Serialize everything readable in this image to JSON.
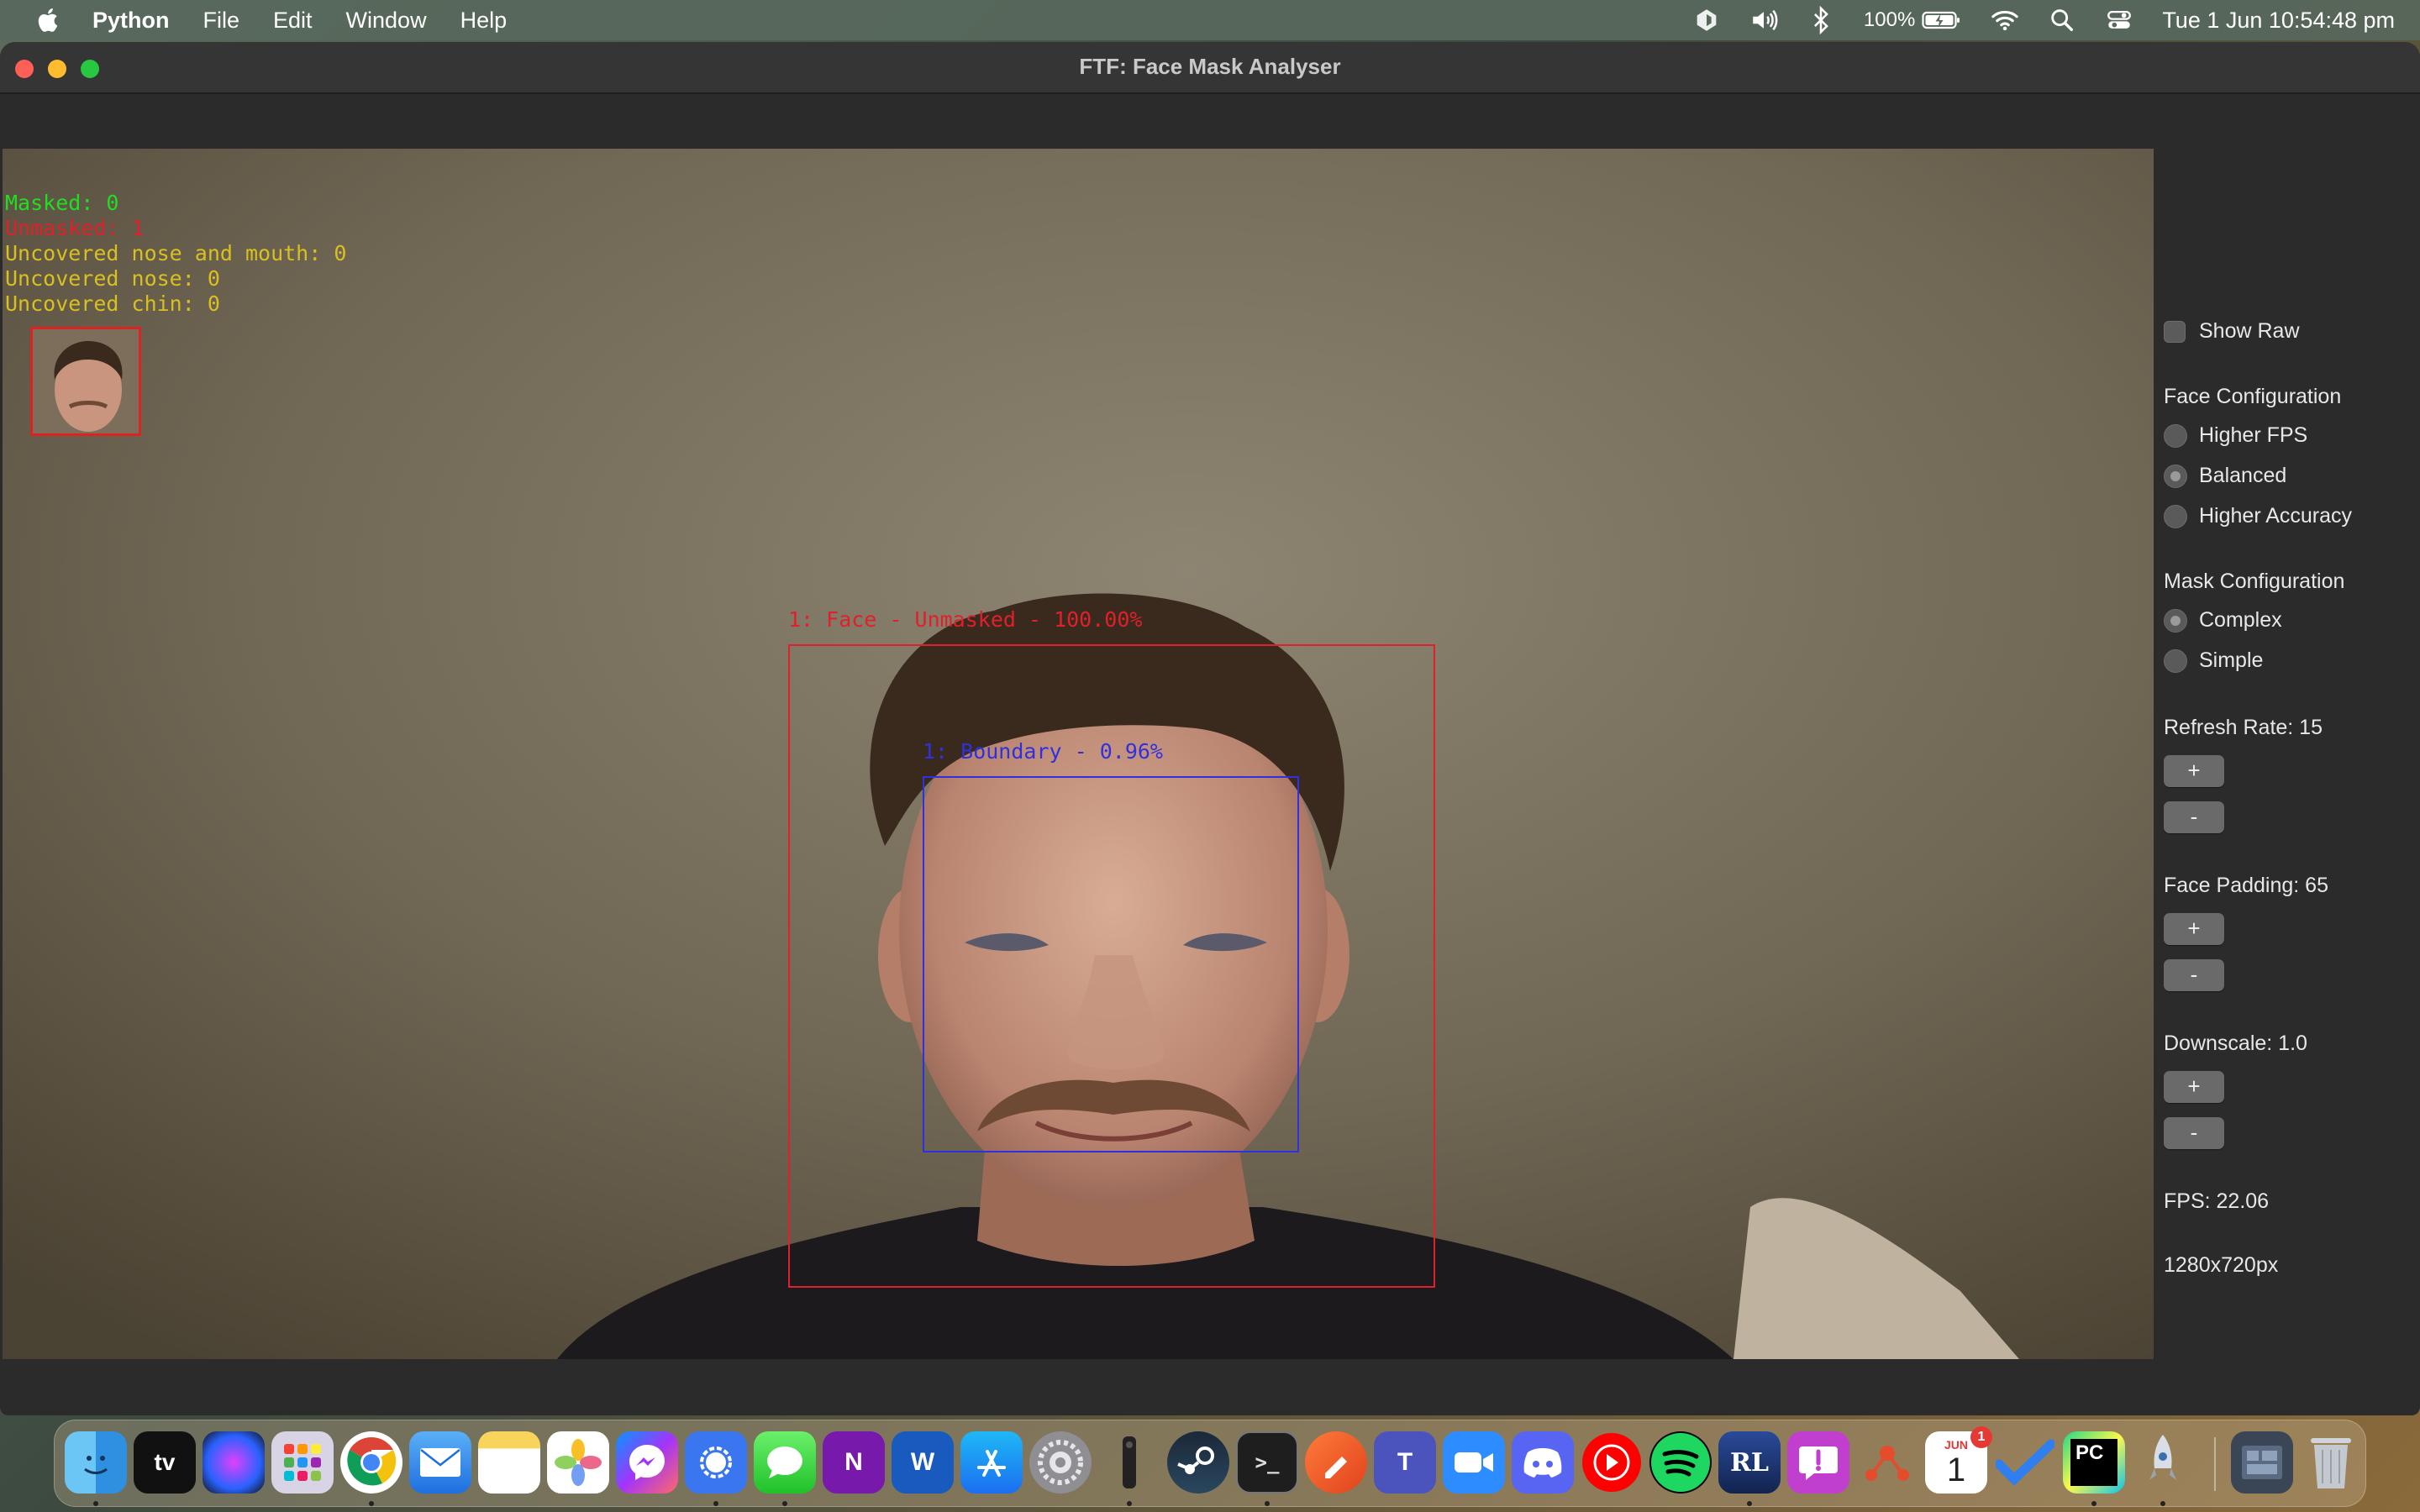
{
  "menubar": {
    "app_name": "Python",
    "menus": [
      "File",
      "Edit",
      "Window",
      "Help"
    ],
    "battery": "100%",
    "clock": "Tue 1 Jun  10:54:48 pm"
  },
  "window": {
    "title": "FTF: Face Mask Analyser"
  },
  "overlay": {
    "masked": "Masked: 0",
    "unmasked": "Unmasked: 1",
    "uncovered_nose_mouth": "Uncovered nose and mouth: 0",
    "uncovered_nose": "Uncovered nose: 0",
    "uncovered_chin": "Uncovered chin: 0",
    "face_label": "1: Face - Unmasked - 100.00%",
    "boundary_label": "1: Boundary - 0.96%",
    "colors": {
      "masked": "#22dd22",
      "unmasked": "#e0202a",
      "uncovered": "#d8c020",
      "boundary": "#3030e0"
    }
  },
  "panel": {
    "show_raw": "Show Raw",
    "face_config_heading": "Face Configuration",
    "face_options": [
      "Higher FPS",
      "Balanced",
      "Higher Accuracy"
    ],
    "face_selected": "Balanced",
    "mask_config_heading": "Mask Configuration",
    "mask_options": [
      "Complex",
      "Simple"
    ],
    "mask_selected": "Complex",
    "refresh_rate": "Refresh Rate: 15",
    "face_padding": "Face Padding: 65",
    "downscale": "Downscale: 1.0",
    "plus": "+",
    "minus": "-",
    "fps": "FPS: 22.06",
    "resolution": "1280x720px"
  },
  "dock": {
    "calendar_month": "JUN",
    "calendar_day": "1",
    "calendar_badge": "1",
    "tv_label": "tv",
    "pc_label": "PC",
    "rl_label": "RL",
    "word_label": "W",
    "onenote_label": "N",
    "teams_label": "T"
  }
}
